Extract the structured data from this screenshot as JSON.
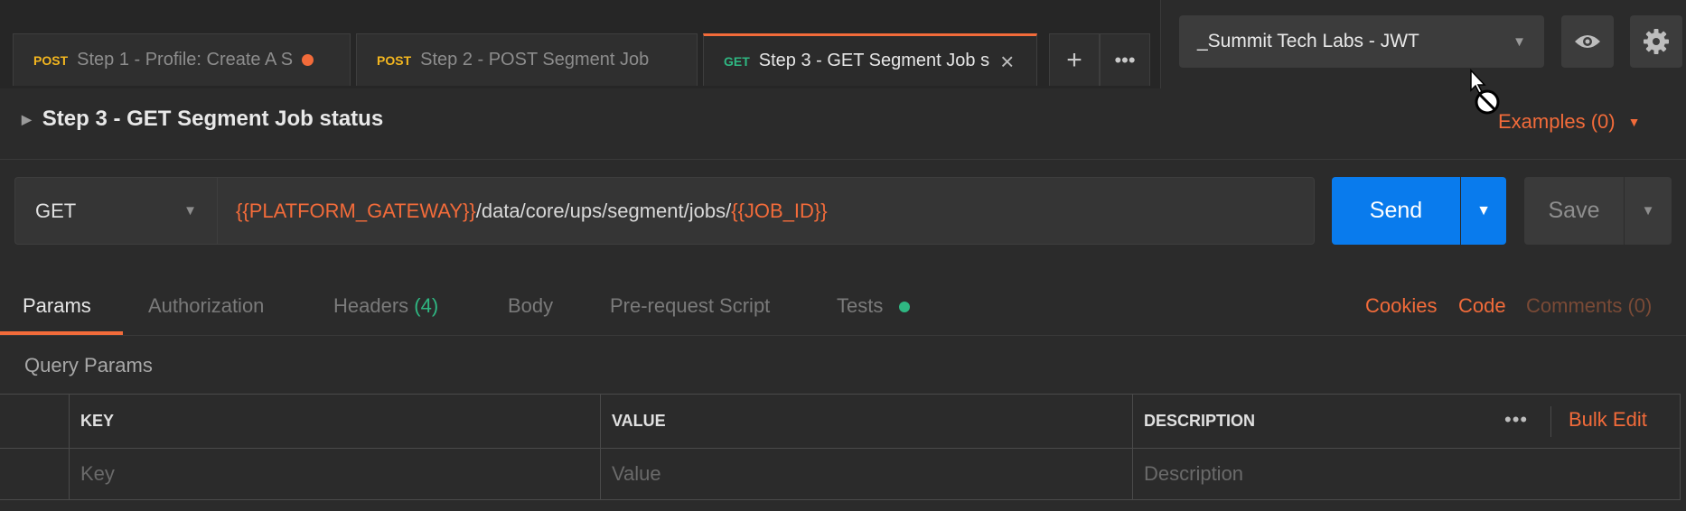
{
  "tabs": [
    {
      "method": "POST",
      "label": "Step 1 - Profile: Create A S",
      "unsaved": true,
      "active": false
    },
    {
      "method": "POST",
      "label": "Step 2 - POST Segment Job",
      "unsaved": false,
      "active": false
    },
    {
      "method": "GET",
      "label": "Step 3 - GET Segment Job s",
      "unsaved": false,
      "active": true
    }
  ],
  "environment": {
    "selected": "_Summit Tech Labs - JWT"
  },
  "request": {
    "title": "Step 3 - GET Segment Job status",
    "examples_label": "Examples (0)",
    "method": "GET",
    "url": {
      "var1": "{{PLATFORM_GATEWAY}}",
      "path": "/data/core/ups/segment/jobs/",
      "var2": "{{JOB_ID}}"
    },
    "send_label": "Send",
    "save_label": "Save"
  },
  "subtabs": {
    "params": "Params",
    "authorization": "Authorization",
    "headers": "Headers",
    "headers_count": "(4)",
    "body": "Body",
    "prerequest": "Pre-request Script",
    "tests": "Tests"
  },
  "links": {
    "cookies": "Cookies",
    "code": "Code",
    "comments": "Comments (0)"
  },
  "query_params": {
    "label": "Query Params",
    "headers": {
      "key": "KEY",
      "value": "VALUE",
      "description": "DESCRIPTION"
    },
    "placeholders": {
      "key": "Key",
      "value": "Value",
      "description": "Description"
    },
    "more": "•••",
    "bulk_edit": "Bulk Edit"
  },
  "colors": {
    "accent": "#f26b3a",
    "send": "#097bed",
    "get": "#2fb782",
    "post": "#f3b61f"
  }
}
